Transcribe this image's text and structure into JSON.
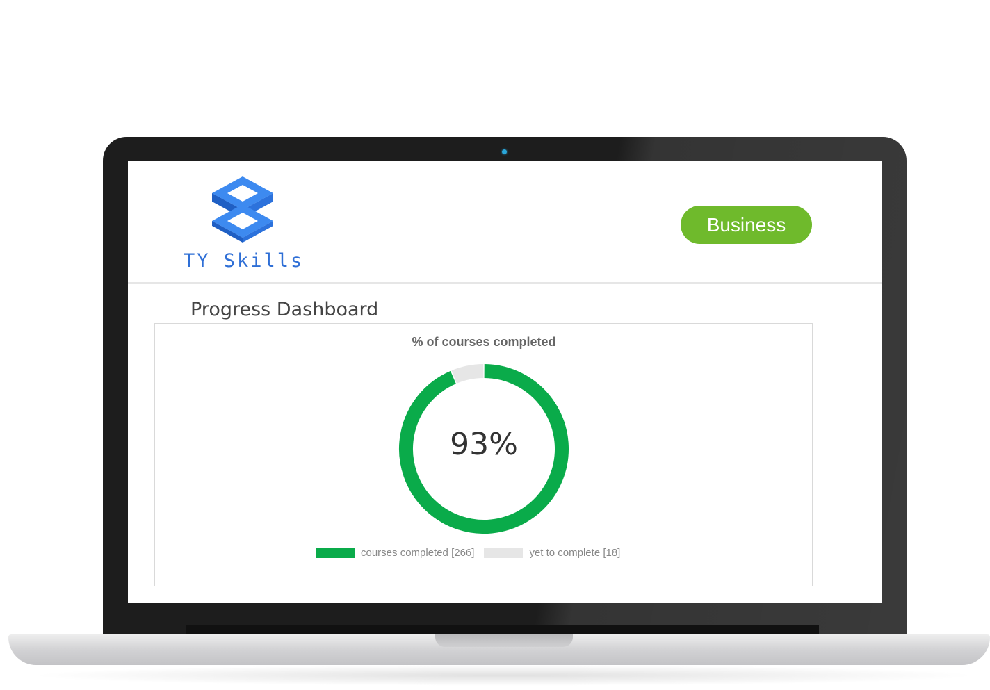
{
  "brand": {
    "name": "TY Skills",
    "color": "#2f6fd6",
    "logo_icon": "stacked-squares-logo-icon"
  },
  "header": {
    "business_label": "Business",
    "business_color": "#6fba2c"
  },
  "page": {
    "title": "Progress Dashboard"
  },
  "chart_data": {
    "type": "pie",
    "title": "% of courses completed",
    "center_label": "93%",
    "legend_placement": "bottom",
    "slices": [
      {
        "label": "courses completed [266]",
        "value": 266,
        "color": "#0aab4a"
      },
      {
        "label": "yet to complete [18]",
        "value": 18,
        "color": "#e6e6e6"
      }
    ]
  }
}
